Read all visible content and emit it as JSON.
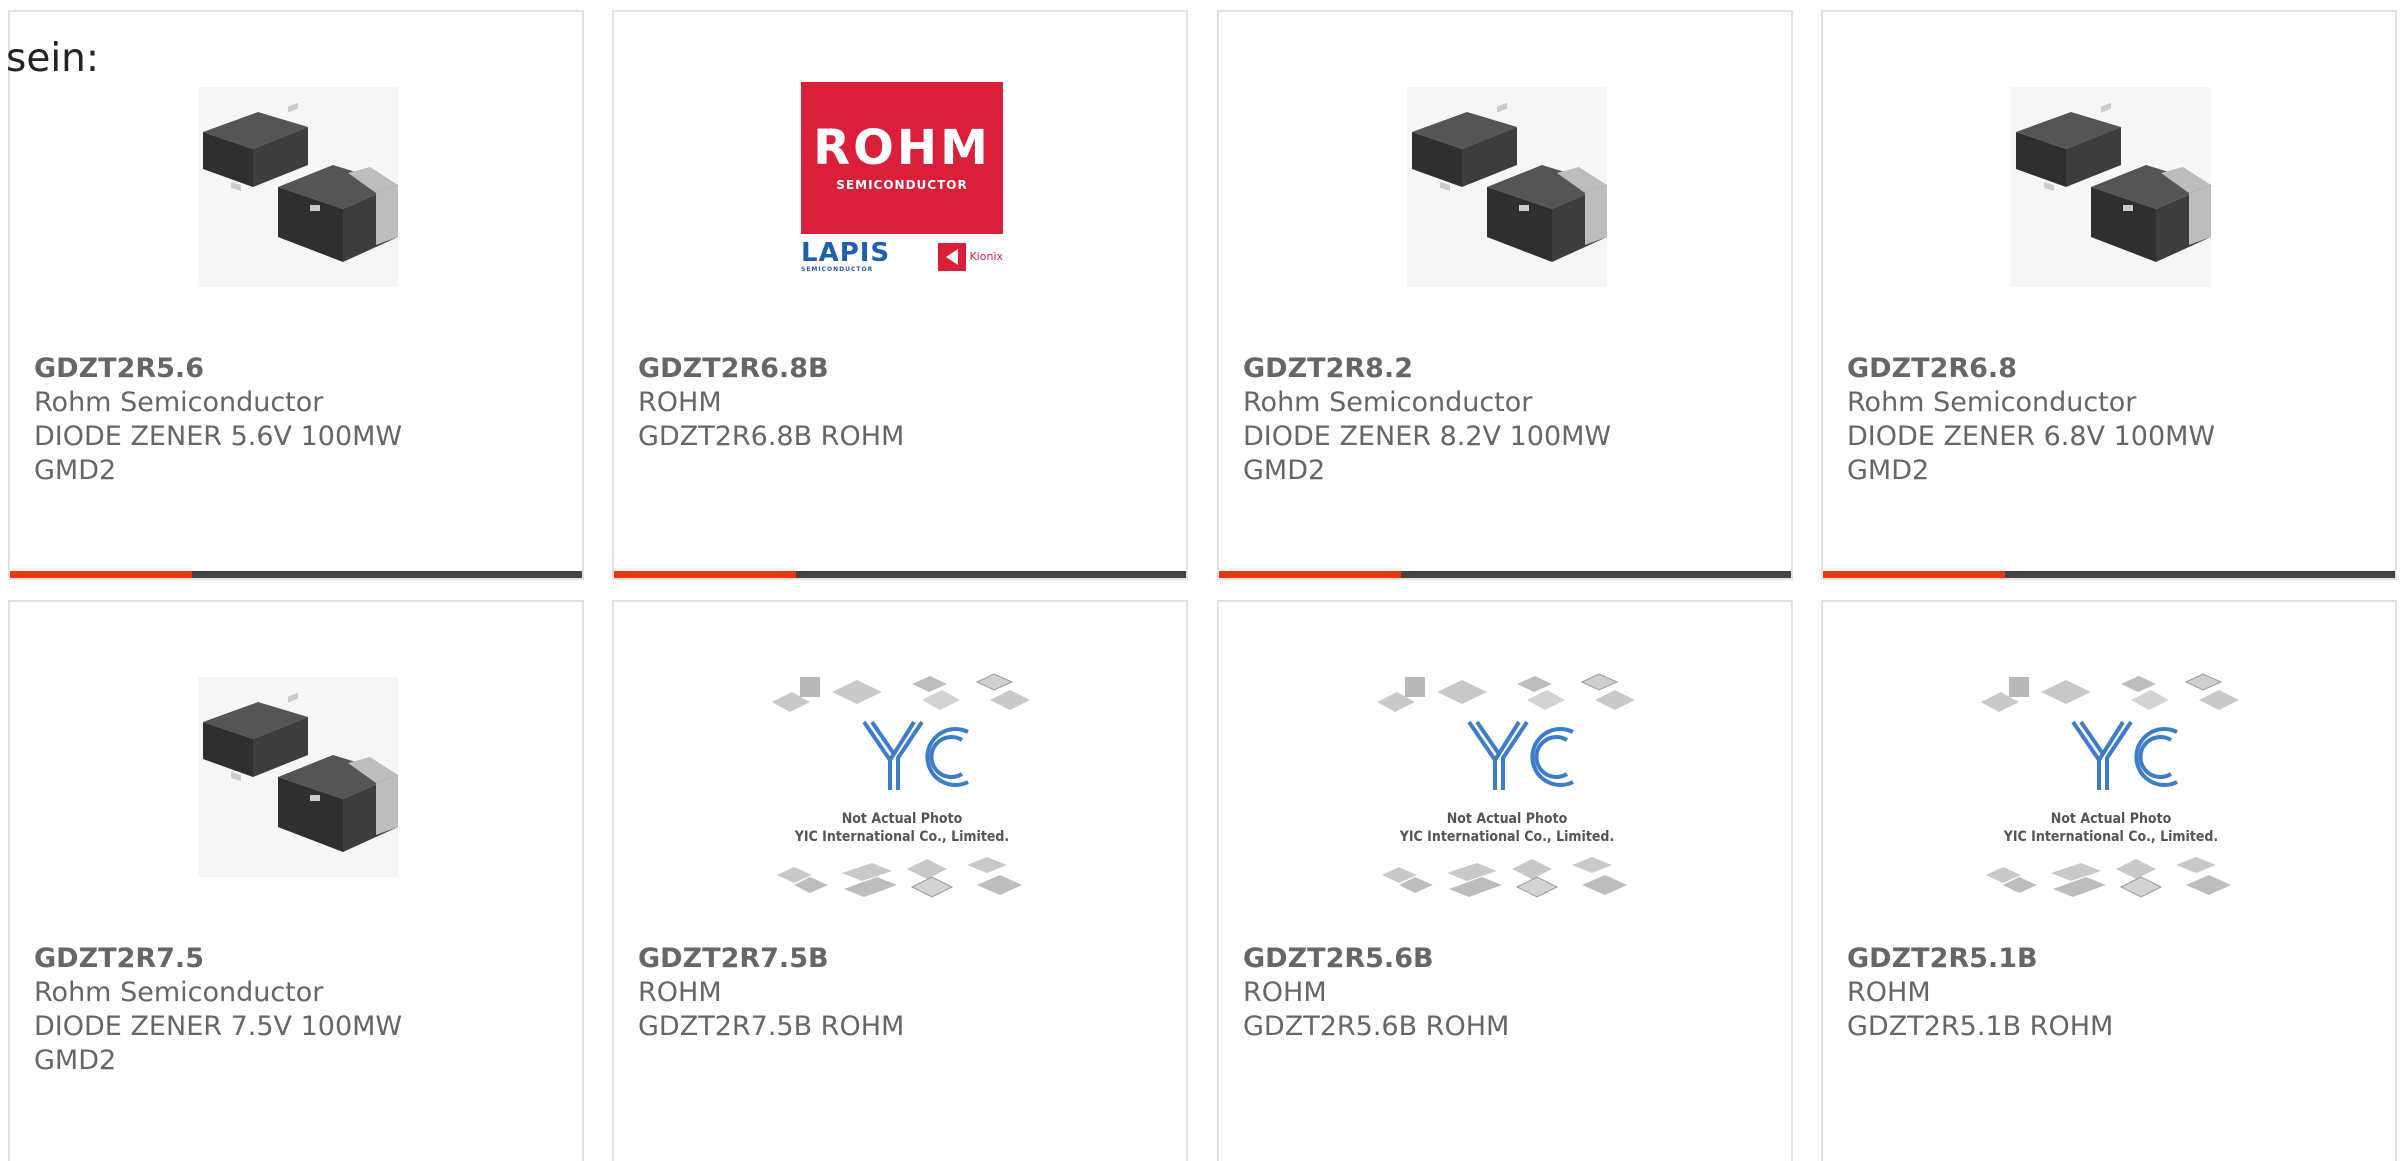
{
  "intro_text": "sein:",
  "colors": {
    "accent": "#e8380d",
    "bar_dark": "#444444",
    "text": "#666666",
    "rohm_red": "#d91f3a",
    "lapis_blue": "#1f5fae"
  },
  "rohm_logo": {
    "wordmark": "ROHM",
    "sub": "SEMICONDUCTOR",
    "lapis": "LAPIS",
    "lapis_sub": "SEMICONDUCTOR",
    "kionix": "Kionix"
  },
  "yic_placeholder": {
    "line1": "Not Actual Photo",
    "line2": "YIC International Co., Limited."
  },
  "products": [
    {
      "part_number": "GDZT2R5.6",
      "manufacturer": "Rohm Semiconductor",
      "description": "DIODE ZENER 5.6V 100MW",
      "package": "GMD2",
      "image": "diode-package-image"
    },
    {
      "part_number": "GDZT2R6.8B",
      "manufacturer": "ROHM",
      "description": "GDZT2R6.8B ROHM",
      "package": "",
      "image": "rohm-logo-image"
    },
    {
      "part_number": "GDZT2R8.2",
      "manufacturer": "Rohm Semiconductor",
      "description": "DIODE ZENER 8.2V 100MW",
      "package": "GMD2",
      "image": "diode-package-image"
    },
    {
      "part_number": "GDZT2R6.8",
      "manufacturer": "Rohm Semiconductor",
      "description": "DIODE ZENER 6.8V 100MW",
      "package": "GMD2",
      "image": "diode-package-image"
    },
    {
      "part_number": "GDZT2R7.5",
      "manufacturer": "Rohm Semiconductor",
      "description": "DIODE ZENER 7.5V 100MW",
      "package": "GMD2",
      "image": "diode-package-image"
    },
    {
      "part_number": "GDZT2R7.5B",
      "manufacturer": "ROHM",
      "description": "GDZT2R7.5B ROHM",
      "package": "",
      "image": "yic-placeholder-image"
    },
    {
      "part_number": "GDZT2R5.6B",
      "manufacturer": "ROHM",
      "description": "GDZT2R5.6B ROHM",
      "package": "",
      "image": "yic-placeholder-image"
    },
    {
      "part_number": "GDZT2R5.1B",
      "manufacturer": "ROHM",
      "description": "GDZT2R5.1B ROHM",
      "package": "",
      "image": "yic-placeholder-image"
    }
  ]
}
